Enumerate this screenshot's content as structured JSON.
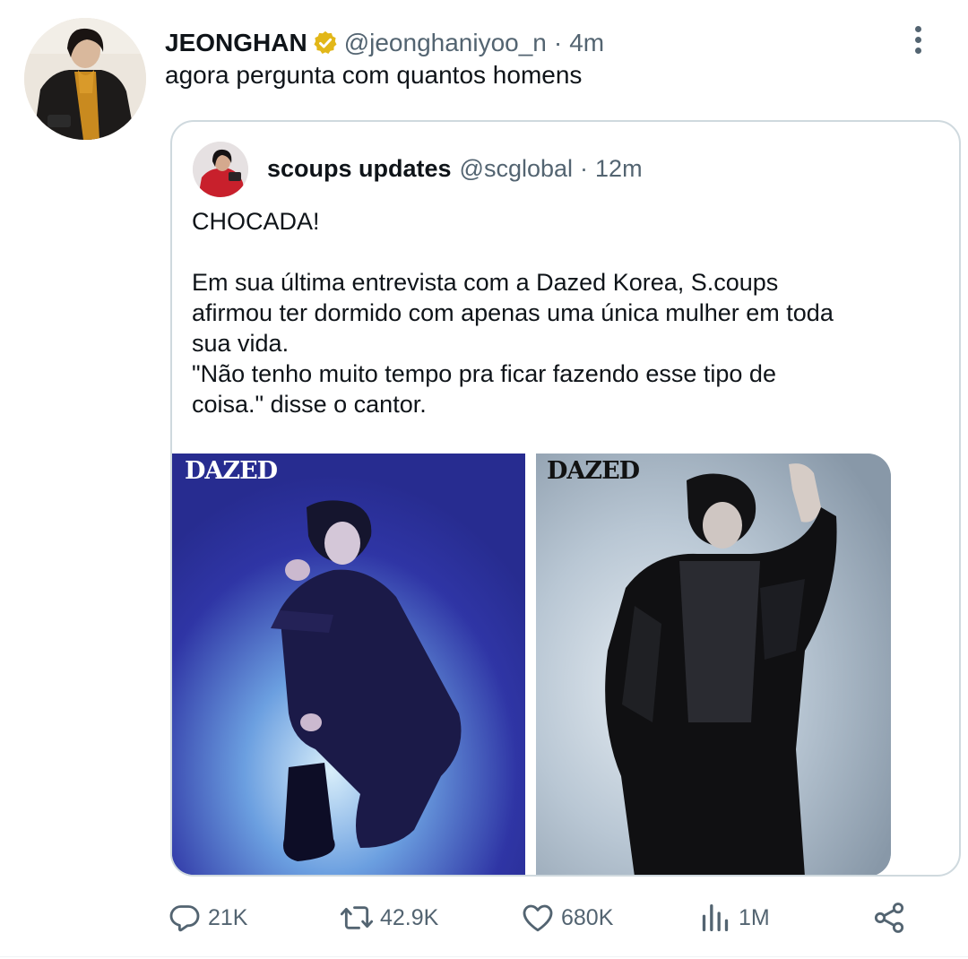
{
  "tweet": {
    "display_name": "JEONGHAN",
    "handle": "@jeonghaniyoo_n",
    "separator": "·",
    "time": "4m",
    "text": "agora pergunta com quantos homens",
    "verified_color": "#e2b719"
  },
  "quote": {
    "display_name": "scoups updates",
    "handle": "@scglobal",
    "separator": "·",
    "time": "12m",
    "text": "CHOCADA!\n\nEm sua última entrevista com a Dazed Korea, S.coups\nafirmou ter dormido com apenas uma única mulher em toda\nsua vida.\n\"Não tenho muito tempo pra ficar fazendo esse tipo de\ncoisa.\" disse o cantor.",
    "media": [
      {
        "logo": "DAZED"
      },
      {
        "logo": "DAZED"
      }
    ]
  },
  "actions": {
    "replies": "21K",
    "retweets": "42.9K",
    "likes": "680K",
    "views": "1M",
    "icons": [
      "reply-icon",
      "retweet-icon",
      "heart-icon",
      "views-icon",
      "share-icon"
    ]
  },
  "colors": {
    "text_primary": "#0f1419",
    "text_secondary": "#536471",
    "border": "#cfd9de"
  }
}
